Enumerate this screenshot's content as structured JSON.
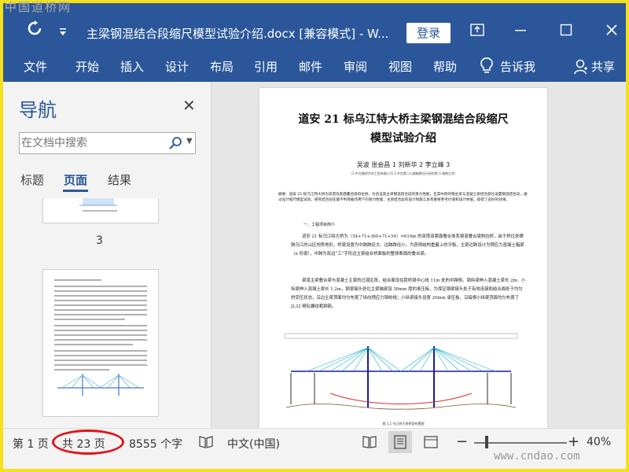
{
  "window": {
    "title": "主梁钢混结合段缩尺模型试验介绍.docx [兼容模式]  -  W...",
    "login_label": "登录"
  },
  "icons": [
    "refresh-icon",
    "customize-toolbar-icon",
    "ribbon-display-icon",
    "minimize-icon",
    "maximize-icon",
    "close-icon",
    "lightbulb-icon",
    "user-share-icon",
    "search-icon",
    "read-mode-icon",
    "print-layout-icon",
    "web-layout-icon",
    "proofing-icon"
  ],
  "ribbon": {
    "tabs": [
      "文件",
      "开始",
      "插入",
      "设计",
      "布局",
      "引用",
      "邮件",
      "审阅",
      "视图",
      "帮助"
    ],
    "tell_me": "告诉我",
    "share": "共享"
  },
  "nav": {
    "title": "导航",
    "search_placeholder": "在文档中搜索",
    "tabs": [
      "标题",
      "页面",
      "结果"
    ],
    "active_tab": "页面",
    "thumb_page_number": "3"
  },
  "document": {
    "title_line1": "道安 21 标乌江特大桥主梁钢混结合段缩尺",
    "title_line2": "模型试验介绍",
    "authors": "吴波   张会昌 1   刘新华 2   李立峰 3",
    "affiliation": "（1.中交路桥华东工程有限公司  2.中交第二公路勘察设计研究院  3.湖南大学）",
    "abstract": "摘要：道安 21 标乌江特大桥为双塔双索面叠合梁斜拉桥，为验证其主梁钢混结合段的受力性能，在其中跨的钢主梁与混凝土梁结合部位设置钢混结合段，通过设计缩尺模型试验，研究结合段在最不利荷载作用下的受力性能，主梁结合段的设计和施工具有重要参考价值和设计依据，取得了良好的效果。",
    "section_heading": "一、工程项目简介",
    "para1": "道安 21 标乌江特大桥为（54+71+360+71+54）=610m 的双塔双索面叠合体系钢混叠合梁斜拉桥，由于桥位处横跨乌江的山区地势地形，桥梁设置为中跨跨径大、边跨跨径小，为获得结构重量上的平衡，主梁边跨设计为预应力混凝土箱梁（π 形梁），中跨为双边“工”字形边主梁结合桥面板的整体断面的叠合梁。",
    "para2": "梁混主梁叠合梁与混凝土主梁的过渡区段，结合面设在距桥墩中心线 11m 处的中跨侧。钢纵梁伸入混凝土梁长 2m，小纵梁伸入混凝土梁长 1.2m，钢梁接头处位主梁端部设 30mm 厚的承压板，为保证钢梁接头处于有效连接和结合面处于均匀的受压状态，沿边主梁顶面均匀布置了纵向预应力钢绞线；小纵梁接头设置 20mm 承压板，沿每根小纵梁顶面均匀布置了 JL32 精轧螺纹粗钢筋。",
    "figure_caption": "图 1.1   乌江特大桥桥型布置图"
  },
  "status": {
    "page": "第 1 页",
    "page_count": "共 23 页",
    "word_count": "8555 个字",
    "language": "中文(中国)",
    "zoom_minus": "−",
    "zoom_plus": "+",
    "zoom_percent": "40%",
    "zoom_value": 40
  },
  "watermarks": {
    "top": "中国道桥网",
    "bottom": "www.cndao.com"
  },
  "colors": {
    "word_blue": "#2b579a",
    "highlight_red": "#e0141e",
    "frame_yellow": "#f5e11b"
  }
}
